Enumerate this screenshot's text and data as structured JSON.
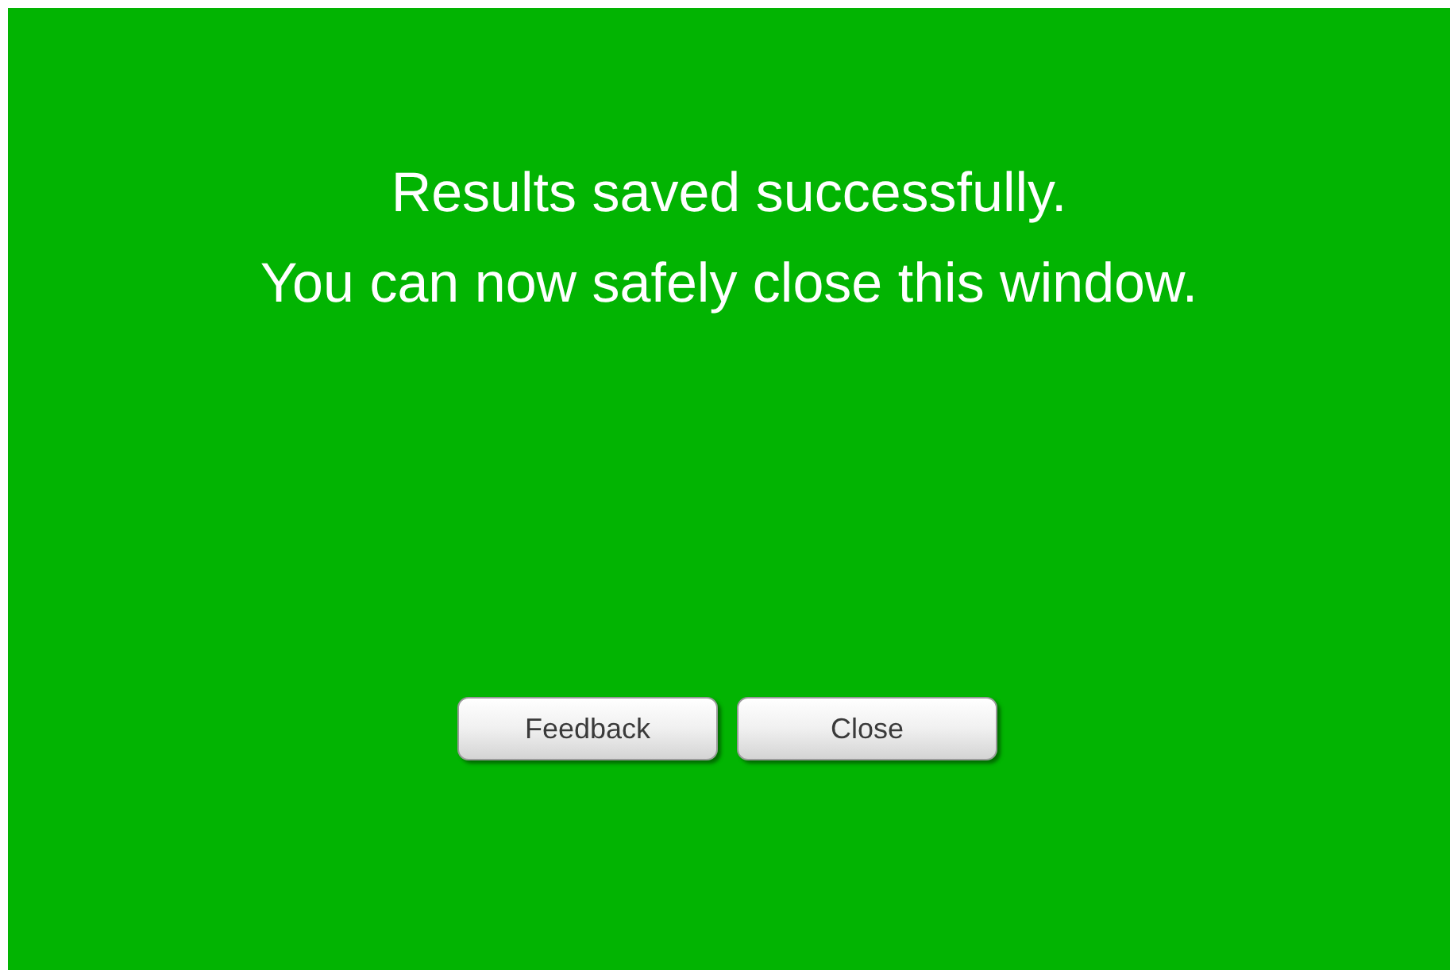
{
  "message_lines": [
    "Results saved successfully.",
    "You can now safely close this window."
  ],
  "buttons": [
    "Feedback",
    "Close"
  ]
}
